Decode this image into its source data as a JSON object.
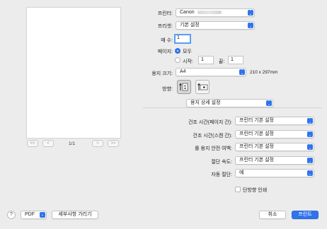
{
  "preview": {
    "first_label": "<<",
    "prev_label": "<",
    "next_label": ">",
    "last_label": ">>",
    "page_indicator": "1/1"
  },
  "printer": {
    "label": "프린터:",
    "value": "Canon"
  },
  "preset": {
    "label": "프리셋:",
    "value": "기본 설정"
  },
  "copies": {
    "label": "매 수:",
    "value": "1"
  },
  "pages": {
    "label": "페이지:",
    "all_label": "모두",
    "from_label": "시작:",
    "from_value": "1",
    "to_label": "끝:",
    "to_value": "1"
  },
  "paper_size": {
    "label": "용지 크기:",
    "value": "A4",
    "dimensions": "210 x 297mm"
  },
  "orientation": {
    "label": "방향:",
    "selected": "portrait"
  },
  "section_popup": {
    "value": "용지 상세 설정"
  },
  "settings": [
    {
      "label": "건조 시간(페이지 간):",
      "value": "프린터 기본 설정"
    },
    {
      "label": "건조 시간(스캔 간):",
      "value": "프린터 기본 설정"
    },
    {
      "label": "롤 용지 안전 여백:",
      "value": "프린터 기본 설정"
    },
    {
      "label": "절단 속도:",
      "value": "프린터 기본 설정"
    },
    {
      "label": "자동 절단:",
      "value": "예"
    }
  ],
  "one_sided": {
    "label": "단방향 인쇄",
    "checked": false
  },
  "footer": {
    "help_label": "?",
    "pdf_label": "PDF",
    "hide_details_label": "세부사항 가리기",
    "cancel_label": "취소",
    "print_label": "프린트"
  },
  "colors": {
    "accent": "#2f74ed",
    "background": "#ececec"
  }
}
